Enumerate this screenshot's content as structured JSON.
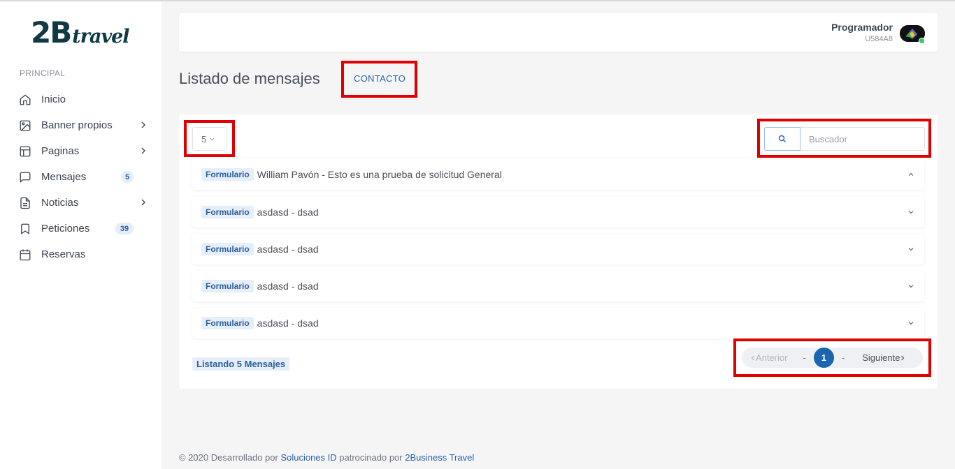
{
  "brand": {
    "logo_main": "2B",
    "logo_sub": "travel"
  },
  "sidebar": {
    "section_label": "PRINCIPAL",
    "items": [
      {
        "label": "Inicio",
        "icon": "home-icon"
      },
      {
        "label": "Banner propios",
        "icon": "image-icon",
        "has_submenu": true
      },
      {
        "label": "Paginas",
        "icon": "layout-icon",
        "has_submenu": true
      },
      {
        "label": "Mensajes",
        "icon": "message-icon",
        "badge": "5"
      },
      {
        "label": "Noticias",
        "icon": "document-icon",
        "has_submenu": true
      },
      {
        "label": "Peticiones",
        "icon": "bookmark-icon",
        "badge": "39"
      },
      {
        "label": "Reservas",
        "icon": "calendar-icon"
      }
    ]
  },
  "header": {
    "user_name": "Programador",
    "user_code": "U584A8",
    "status_color": "#2ecc71"
  },
  "page": {
    "title": "Listado de mensajes",
    "contact_link": "CONTACTO"
  },
  "toolbar": {
    "page_size": "5",
    "search_placeholder": "Buscador"
  },
  "messages": [
    {
      "tag": "Formulario",
      "text": "William Pavón - Esto es una prueba de solicitud General",
      "expanded": true
    },
    {
      "tag": "Formulario",
      "text": "asdasd - dsad",
      "expanded": false
    },
    {
      "tag": "Formulario",
      "text": "asdasd - dsad",
      "expanded": false
    },
    {
      "tag": "Formulario",
      "text": "asdasd - dsad",
      "expanded": false
    },
    {
      "tag": "Formulario",
      "text": "asdasd - dsad",
      "expanded": false
    }
  ],
  "listing_count": "Listando 5 Mensajes",
  "pagination": {
    "prev": "Anterior",
    "separator": "-",
    "current": "1",
    "next": "Siguiente"
  },
  "footer": {
    "prefix": "© 2020 Desarrollado por ",
    "dev_link": "Soluciones ID",
    "middle": " patrocinado por ",
    "sponsor_link": "2Business Travel"
  },
  "colors": {
    "accent": "#1a65b0",
    "highlight_border": "#e00000",
    "brand": "#0f3a45"
  }
}
